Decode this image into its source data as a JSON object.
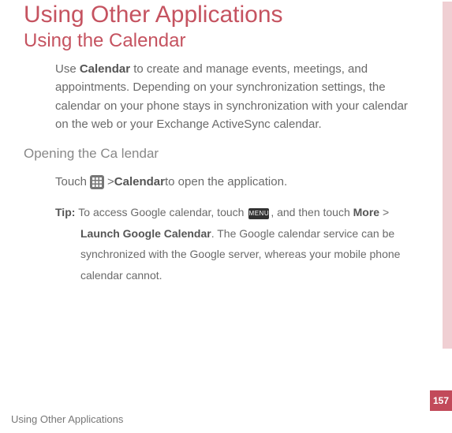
{
  "h1": "Using Other Applications",
  "h2": "Using the Calendar",
  "intro": {
    "t1": "Use ",
    "bold1": "Calendar",
    "t2": " to create and manage events, meetings, and appointments. Depending on your synchronization settings, the calendar on your phone stays in synchronization with your calendar on the web or your Exchange ActiveSync calendar."
  },
  "h3": "Opening the  Ca lendar",
  "touch": {
    "t1": "Touch ",
    "gt": " > ",
    "bold": "Calendar",
    "t2": " to open the application."
  },
  "tip": {
    "label": "Tip:  ",
    "t1": "To access Google calendar,  touch ",
    "menu_glyph": "MENU",
    "t2": ", and then touch ",
    "bold1": "More",
    "t3": " > ",
    "bold2": "Launch Google Calendar",
    "t4": ". The Google calendar service can be synchronized with the Google server, whereas your mobile phone calendar cannot."
  },
  "footer": "Using Other Applications",
  "page_number": "157"
}
